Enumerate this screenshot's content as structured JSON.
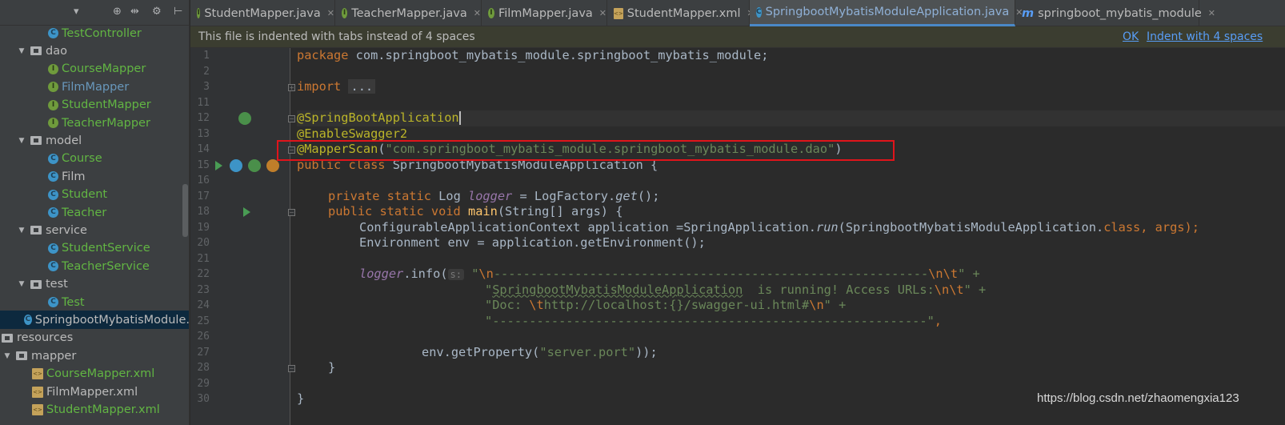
{
  "sidebar": {
    "toolbar_glyphs": [
      "▾",
      "⊕",
      "⇹",
      "⚙",
      "⊢"
    ],
    "tree": [
      {
        "label": "TestController",
        "icon": "class-icon",
        "color": "green"
      },
      {
        "label": "dao",
        "icon": "folder-icon",
        "expanded": true,
        "color": "plain"
      },
      {
        "label": "CourseMapper",
        "icon": "interface-icon",
        "color": "green"
      },
      {
        "label": "FilmMapper",
        "icon": "interface-icon",
        "color": "blue"
      },
      {
        "label": "StudentMapper",
        "icon": "interface-icon",
        "color": "green"
      },
      {
        "label": "TeacherMapper",
        "icon": "interface-icon",
        "color": "green"
      },
      {
        "label": "model",
        "icon": "folder-icon",
        "expanded": true,
        "color": "plain"
      },
      {
        "label": "Course",
        "icon": "class-icon",
        "color": "green"
      },
      {
        "label": "Film",
        "icon": "class-icon",
        "color": "plain"
      },
      {
        "label": "Student",
        "icon": "class-icon",
        "color": "green"
      },
      {
        "label": "Teacher",
        "icon": "class-icon",
        "color": "green"
      },
      {
        "label": "service",
        "icon": "folder-icon",
        "expanded": true,
        "color": "plain"
      },
      {
        "label": "StudentService",
        "icon": "class-icon",
        "color": "green"
      },
      {
        "label": "TeacherService",
        "icon": "class-icon",
        "color": "green"
      },
      {
        "label": "test",
        "icon": "folder-icon",
        "expanded": true,
        "color": "plain"
      },
      {
        "label": "Test",
        "icon": "class-icon",
        "color": "green"
      },
      {
        "label": "SpringbootMybatisModule.",
        "icon": "spring-class-icon",
        "color": "plain",
        "selected": true
      },
      {
        "label": "resources",
        "icon": "folder-icon",
        "color": "plain"
      },
      {
        "label": "mapper",
        "icon": "folder-icon",
        "expanded": true,
        "color": "plain"
      },
      {
        "label": "CourseMapper.xml",
        "icon": "xml-icon",
        "color": "green"
      },
      {
        "label": "FilmMapper.xml",
        "icon": "xml-icon",
        "color": "plain"
      },
      {
        "label": "StudentMapper.xml",
        "icon": "xml-icon",
        "color": "green"
      }
    ]
  },
  "tabs": [
    {
      "label": "StudentMapper.java",
      "icon": "interface-icon"
    },
    {
      "label": "TeacherMapper.java",
      "icon": "interface-icon"
    },
    {
      "label": "FilmMapper.java",
      "icon": "interface-icon"
    },
    {
      "label": "StudentMapper.xml",
      "icon": "xml-icon"
    },
    {
      "label": "SpringbootMybatisModuleApplication.java",
      "icon": "spring-class-icon",
      "active": true
    },
    {
      "label": "springboot_mybatis_module",
      "icon": "maven-icon"
    }
  ],
  "notification": {
    "text": "This file is indented with tabs instead of 4 spaces",
    "ok": "OK",
    "indent": "Indent with 4 spaces"
  },
  "editor": {
    "line_numbers": [
      "1",
      "2",
      "3",
      "11",
      "12",
      "13",
      "14",
      "15",
      "16",
      "17",
      "18",
      "19",
      "20",
      "21",
      "22",
      "23",
      "24",
      "25",
      "26",
      "27",
      "28",
      "29",
      "30"
    ],
    "inlay_hint": "s:",
    "code": {
      "l1_kw": "package",
      "l1_rest": " com.springboot_mybatis_module.springboot_mybatis_module;",
      "l3_kw": "import",
      "l3_fold": "...",
      "l12": "@SpringBootApplication",
      "l13": "@EnableSwagger2",
      "l14_ann": "@MapperScan",
      "l14_open": "(",
      "l14_str": "\"com.springboot_mybatis_module.springboot_mybatis_module.dao\"",
      "l14_close": ")",
      "l15_kw": "public class",
      "l15_rest": " SpringbootMybatisModuleApplication {",
      "l17_kw": "private static",
      "l17_type": " Log ",
      "l17_field": "logger",
      "l17_eq": " = LogFactory.",
      "l17_get": "get",
      "l17_end": "();",
      "l18_kw": "public static void",
      "l18_sp": " ",
      "l18_main": "main",
      "l18_rest": "(String[] args) {",
      "l19_a": "ConfigurableApplicationContext application =SpringApplication.",
      "l19_run": "run",
      "l19_b": "(SpringbootMybatisModuleApplication.",
      "l19_class": "class",
      "l19_c": ", args);",
      "l20": "Environment env = application.getEnvironment();",
      "l22_field": "logger",
      "l22_info": ".info(",
      "l22_q": "\"",
      "l22_esc1": "\\n",
      "l22_dash": "-----------------------------------------------------------",
      "l22_esc2": "\\n\\t",
      "l22_end": "\" +",
      "l23_q": "\"",
      "l23_sb": "SpringbootMybatisModuleApplication",
      "l23_txt": "  is running! Access URLs:",
      "l23_esc": "\\n\\t",
      "l23_end": "\" +",
      "l24_a": "\"Doc: ",
      "l24_esc1": "\\t",
      "l24_b": "http://localhost:{}/swagger-ui.html#",
      "l24_esc2": "\\n",
      "l24_end": "\" +",
      "l25_str": "\"-----------------------------------------------------------\"",
      "l25_comma": ",",
      "l27_a": "env.getProperty(",
      "l27_str": "\"server.port\"",
      "l27_end": "));",
      "l28": "}",
      "l30": "}"
    }
  },
  "watermark": "https://blog.csdn.net/zhaomengxia123"
}
